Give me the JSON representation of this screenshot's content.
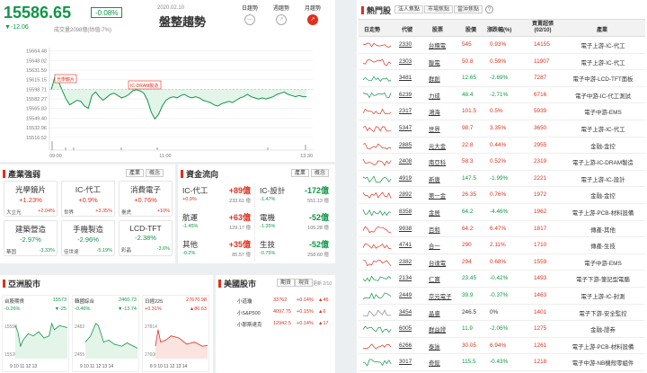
{
  "header": {
    "index": "15586.65",
    "change_pct": "-0.08%",
    "change": "▼-12.06",
    "volume": "成交量2098億(估值-7%)",
    "date": "2020.02.10",
    "trend": "盤整趨勢",
    "tabs": [
      "日趨勢",
      "週趨勢",
      "月趨勢"
    ]
  },
  "intraday": {
    "y_ticks": [
      "15664.48",
      "15648.02",
      "15631.59",
      "15615.15",
      "15598.71",
      "15582.27",
      "15565.83",
      "15549.40",
      "15532.96",
      "15516.52"
    ],
    "x_ticks": [
      "09:00",
      "11:00",
      "13:30"
    ],
    "events": [
      "光學鏡片",
      "IC-DRAM製造"
    ],
    "ymin": 15510,
    "ymax": 15670,
    "series": [
      15598,
      15620,
      15612,
      15596,
      15582,
      15572,
      15576,
      15580,
      15578,
      15570,
      15566,
      15588,
      15594,
      15586,
      15580,
      15585,
      15590,
      15592,
      15588,
      15584,
      15586,
      15590,
      15596,
      15598,
      15596,
      15592,
      15580,
      15560,
      15548,
      15556,
      15570,
      15580,
      15584,
      15586,
      15584,
      15588,
      15590,
      15586,
      15584,
      15586,
      15584,
      15580,
      15578,
      15576,
      15572,
      15570,
      15574,
      15576,
      15578,
      15576,
      15580,
      15584,
      15586,
      15590,
      15586,
      15584,
      15582,
      15584,
      15582,
      15584,
      15586,
      15590,
      15592,
      15594,
      15590,
      15588,
      15586,
      15588,
      15586,
      15586
    ]
  },
  "industry": {
    "title": "產業強弱",
    "tabs": [
      "產業",
      "概念"
    ],
    "items": [
      {
        "name": "光學鏡片",
        "pct": "+1.23%",
        "stock": "大立光",
        "spct": "+2.04%"
      },
      {
        "name": "IC-代工",
        "pct": "+0.9%",
        "stock": "世界",
        "spct": "+3.35%"
      },
      {
        "name": "消費電子",
        "pct": "+0.76%",
        "stock": "臺虎",
        "spct": "+10%"
      },
      {
        "name": "建築營造",
        "pct": "-2.97%",
        "stock": "華固",
        "spct": "-3.33%"
      },
      {
        "name": "手機製造",
        "pct": "-2.96%",
        "stock": "佳世達",
        "spct": "-5.19%"
      },
      {
        "name": "LCD-TFT",
        "pct": "-2.38%",
        "stock": "彩晶",
        "spct": "-3.6%"
      }
    ]
  },
  "capital": {
    "title": "資金流向",
    "tabs": [
      "產業",
      "概念"
    ],
    "items": [
      {
        "name": "IC-代工",
        "pct": "+0.9%",
        "amt": "+89億",
        "vol": "233.61 億"
      },
      {
        "name": "IC-設計",
        "pct": "-1.47%",
        "amt": "-172億",
        "vol": "551.13 億"
      },
      {
        "name": "航運",
        "pct": "-1.45%",
        "amt": "+63億",
        "vol": "129.17 億"
      },
      {
        "name": "電機",
        "pct": "-1.35%",
        "amt": "-52億",
        "vol": "105.28 億"
      },
      {
        "name": "其他",
        "pct": "-0.2%",
        "amt": "+35億",
        "vol": "85.57 億"
      },
      {
        "name": "生技",
        "pct": "-0.75%",
        "amt": "-52億",
        "vol": "258.60 億"
      }
    ]
  },
  "asia": {
    "title": "亞洲股市",
    "markets": [
      {
        "name": "台股期貨",
        "value": "15573",
        "pct": "-0.26%",
        "chg": "▼-25",
        "ticks": [
          "15550",
          "15520"
        ],
        "x": "9 10 11 12 13"
      },
      {
        "name": "韓國綜合",
        "value": "2460.73",
        "pct": "-0.46%",
        "chg": "▼-13.74",
        "ticks": [
          "2482",
          "2455"
        ],
        "x": "9 10 11 12 13 14"
      },
      {
        "name": "日經225",
        "value": "27670.98",
        "pct": "+0.31%",
        "chg": "▲86.63",
        "ticks": [
          "27814",
          "27600"
        ],
        "x": "8 9 10 11 12 13 14"
      }
    ]
  },
  "us": {
    "title": "美國股市",
    "tabs": [
      "期貨",
      "現貨"
    ],
    "updated": "更新 2/10",
    "rows": [
      {
        "name": "小道瓊",
        "value": "33762",
        "pct": "+0.14%",
        "chg": "▲46"
      },
      {
        "name": "小S&P500",
        "value": "4097.75",
        "pct": "+0.15%",
        "chg": "▲6"
      },
      {
        "name": "小那斯達克",
        "value": "12942.5",
        "pct": "+0.14%",
        "chg": "▲17"
      }
    ]
  },
  "hot": {
    "title": "熱門股",
    "tabs": [
      "法人焦點",
      "市場焦點",
      "當沖焦點"
    ],
    "help": "?",
    "headers": [
      "日走勢",
      "代號",
      "股票",
      "股價",
      "漲跌幅(%)",
      "買賣超張\n(02/10)",
      "產業"
    ],
    "rows": [
      [
        "2330",
        "台積電",
        "545",
        "0.93%",
        "14155",
        "電子上游-IC-代工"
      ],
      [
        "2303",
        "聯電",
        "50.8",
        "0.59%",
        "11907",
        "電子上游-IC-代工"
      ],
      [
        "3481",
        "群創",
        "12.65",
        "-2.69%",
        "7287",
        "電子中游-LCD-TFT面板"
      ],
      [
        "6239",
        "力成",
        "48.4",
        "-2.71%",
        "6716",
        "電子中游-IC-代工測試"
      ],
      [
        "2317",
        "鴻海",
        "101.5",
        "0.5%",
        "5939",
        "電子中游-EMS"
      ],
      [
        "5347",
        "世界",
        "98.7",
        "3.35%",
        "3650",
        "電子上游-IC-代工"
      ],
      [
        "2885",
        "元大金",
        "22.8",
        "0.44%",
        "2955",
        "金融-金控"
      ],
      [
        "2408",
        "南亞科",
        "58.3",
        "0.52%",
        "2319",
        "電子上游-IC-DRAM製造"
      ],
      [
        "4919",
        "新唐",
        "147.5",
        "-1.99%",
        "2221",
        "電子上游-IC-設計"
      ],
      [
        "2892",
        "第一金",
        "26.35",
        "0.76%",
        "1972",
        "金融-金控"
      ],
      [
        "8358",
        "金居",
        "64.2",
        "-4.46%",
        "1962",
        "電子上游-PCB-材料設備"
      ],
      [
        "9938",
        "百和",
        "64.2",
        "6.47%",
        "1817",
        "傳產-其他"
      ],
      [
        "4741",
        "合一",
        "290",
        "2.11%",
        "1710",
        "傳產-生技"
      ],
      [
        "2382",
        "台達電",
        "294",
        "0.68%",
        "1559",
        "電子中游-EMS"
      ],
      [
        "2134",
        "仁寶",
        "23.45",
        "-0.42%",
        "1493",
        "電子下游-筆記型電腦"
      ],
      [
        "2449",
        "京元電子",
        "39.9",
        "-0.37%",
        "1463",
        "電子上游-IC-封測"
      ],
      [
        "3454",
        "晶睿",
        "246.5",
        "0%",
        "1401",
        "電子下游-安全監控"
      ],
      [
        "6005",
        "群益證",
        "11.9",
        "-2.06%",
        "1275",
        "金融-證券"
      ],
      [
        "6266",
        "泰詠",
        "30.05",
        "6.94%",
        "1261",
        "電子上游-PCB-材料設備"
      ],
      [
        "3017",
        "奇鋐",
        "115.5",
        "-0.43%",
        "1218",
        "電子中游-NB機殼零組件"
      ]
    ]
  }
}
